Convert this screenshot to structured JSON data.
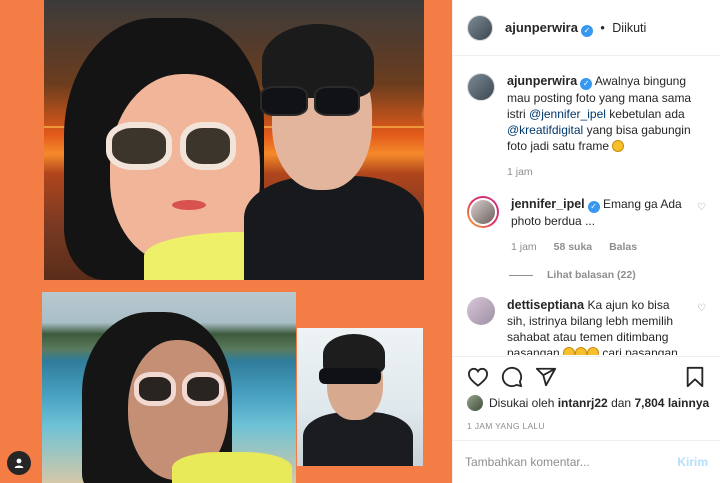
{
  "header": {
    "username": "ajunperwira",
    "separator": "•",
    "follow_status": "Diikuti"
  },
  "caption": {
    "username": "ajunperwira",
    "text_1": "Awalnya bingung mau posting foto yang mana sama istri",
    "mention_1": "@jennifer_ipel",
    "text_2": "kebetulan ada",
    "mention_2": "@kreatifdigital",
    "text_3": "yang bisa gabungin foto jadi satu frame",
    "time": "1 jam"
  },
  "comments": [
    {
      "username": "jennifer_ipel",
      "text": "Emang ga Ada photo berdua ...",
      "time": "1 jam",
      "likes": "58 suka",
      "reply": "Balas",
      "view_replies": "Lihat balasan (22)"
    },
    {
      "username": "dettiseptiana",
      "text_1": "Ka ajun ko bisa sih, istrinya bilang lebh memilih sahabat atau temen ditimbang pasangan",
      "text_2": "cari pasangan makanya yang serius"
    }
  ],
  "likes": {
    "prefix": "Disukai oleh",
    "user": "intanrj22",
    "middle": "dan",
    "count": "7,804 lainnya"
  },
  "timestamp": "1 JAM YANG LALU",
  "add_comment": {
    "placeholder": "Tambahkan komentar...",
    "post_label": "Kirim"
  },
  "icons": [
    "heart-icon",
    "comment-icon",
    "share-icon",
    "bookmark-icon",
    "verified-icon",
    "user-icon"
  ],
  "colors": {
    "accent": "#3897f0",
    "media_bg": "#f47c45",
    "muted": "#8e8e8e",
    "post_disabled": "#b2dffc"
  }
}
